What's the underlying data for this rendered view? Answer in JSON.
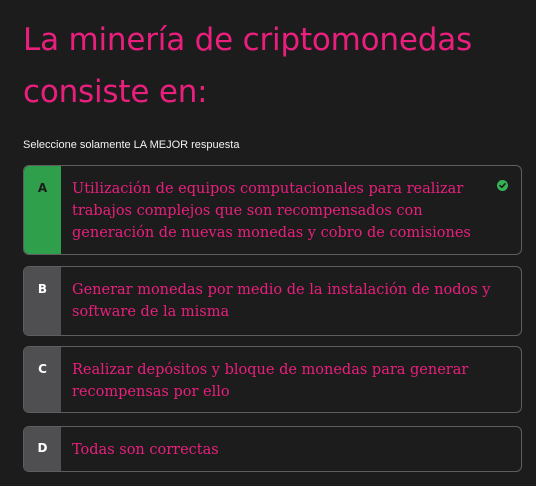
{
  "question": {
    "title": "La minería de criptomonedas consiste en:",
    "instruction": "Seleccione solamente LA MEJOR respuesta"
  },
  "options": [
    {
      "letter": "A",
      "text": "Utilización de equipos computacionales para realizar trabajos complejos que son recompensados con generación de nuevas monedas y cobro de comisiones",
      "selected": true,
      "correct": true
    },
    {
      "letter": "B",
      "text": "Generar monedas por medio de la instalación de nodos y software de la misma",
      "selected": false
    },
    {
      "letter": "C",
      "text": "Realizar depósitos y bloque de monedas para generar recompensas por ello",
      "selected": false
    },
    {
      "letter": "D",
      "text": "Todas son correctas",
      "selected": false
    }
  ],
  "icons": {
    "correct": "check-circle-icon"
  },
  "colors": {
    "background": "#1c1c1d",
    "accent": "#ea1f7d",
    "correct": "#2f9f4b",
    "letter_default": "#4f4f51",
    "border": "#5e5e60"
  }
}
